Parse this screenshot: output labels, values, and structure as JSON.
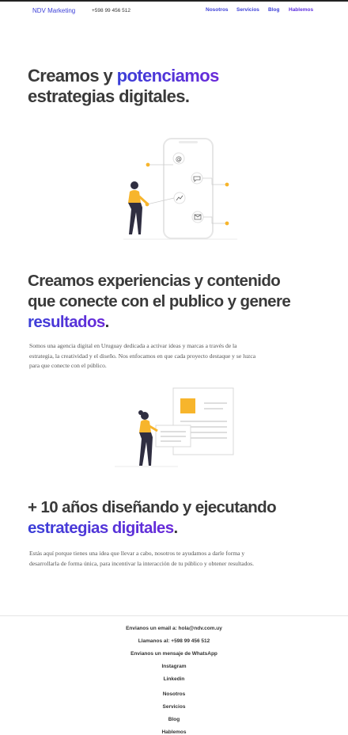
{
  "header": {
    "brand": "NDV Marketing",
    "phone": "+598 99 456 512",
    "nav": [
      "Nosotros",
      "Servicios",
      "Blog",
      "Hablemos"
    ]
  },
  "hero": {
    "line1_start": "Creamos y ",
    "line1_accent": "potenciamos",
    "line2": "estrategias digitales."
  },
  "section2": {
    "line1": "Creamos experiencias y contenido",
    "line2": "que conecte con el publico y genere",
    "accent": "resultados",
    "period": ".",
    "para1": "Somos una agencia digital en Uruguay dedicada a activar ideas y marcas a través de la",
    "para2": "estrategia, la creatividad y el diseño. Nos enfocamos en que cada proyecto destaque y se luzca",
    "para3": "para que conecte con el público."
  },
  "section3": {
    "line1": "+ 10 años diseñando y ejecutando",
    "accent": "estrategias digitales",
    "period": ".",
    "para1": "Estás aquí porque tienes una idea que llevar a cabo, nosotros te ayudamos a darle forma y",
    "para2": "desarrollarla de forma única, para incentivar la interacción de tu público y obtener resultados."
  },
  "footer": {
    "email": "Envianos un email a: hola@ndv.com.uy",
    "call": "Llamanos al: +598 99 456 512",
    "whatsapp": "Envianos un mensaje de WhatsApp",
    "instagram": "Instagram",
    "linkedin": "Linkedin",
    "links": [
      "Nosotros",
      "Servicios",
      "Blog",
      "Hablemos"
    ]
  },
  "colors": {
    "accent_blue": "#3b3fd8",
    "accent_purple": "#6a2ad9",
    "figure_yellow": "#f7b52c",
    "text": "#3a3a3a"
  }
}
